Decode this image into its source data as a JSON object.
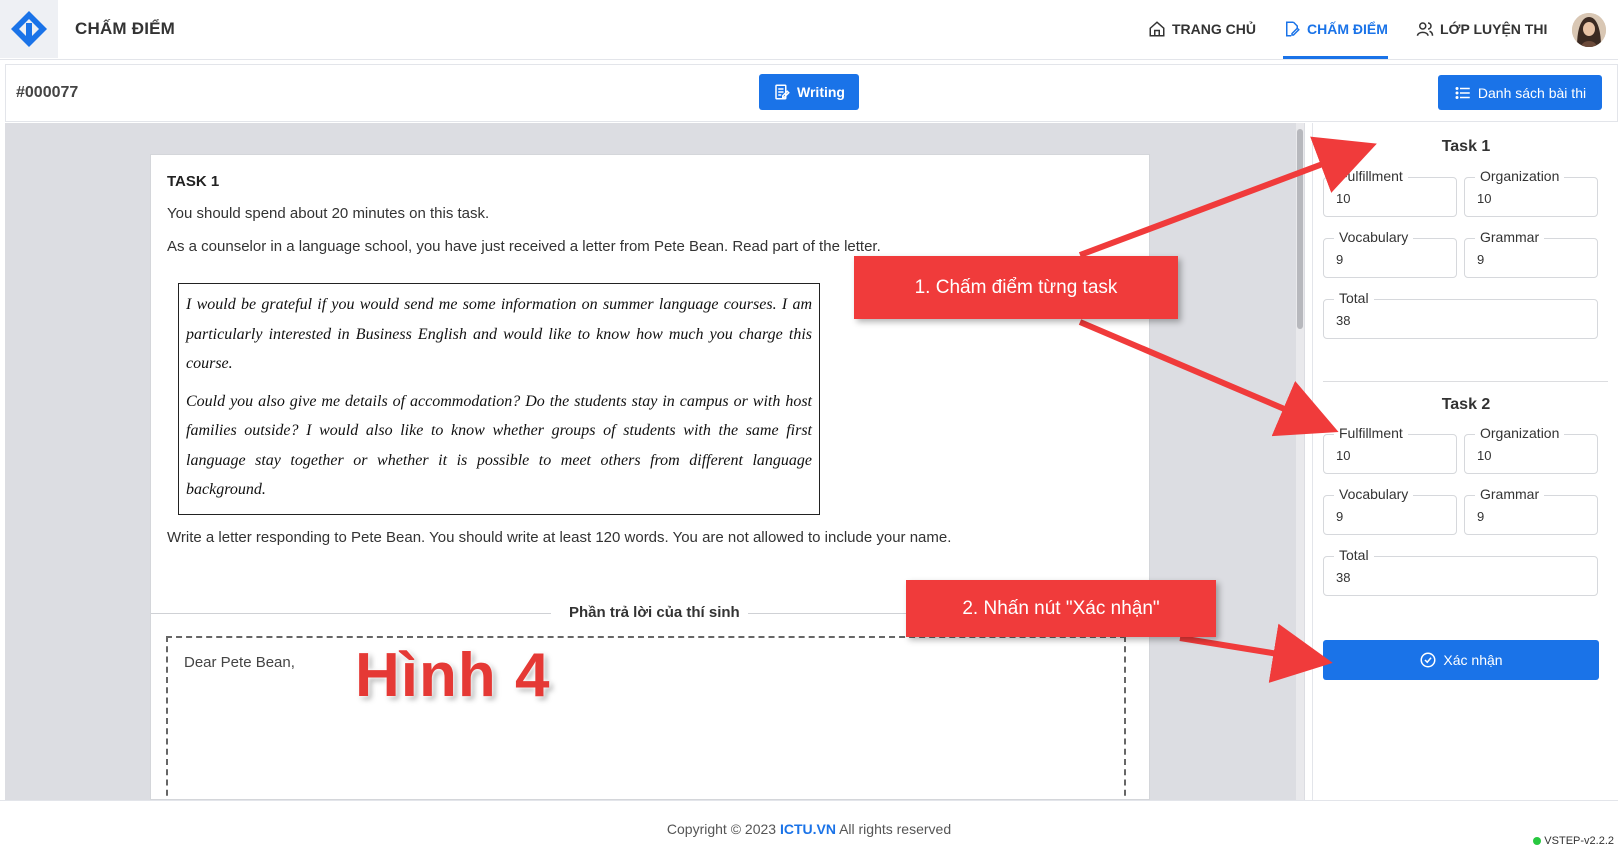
{
  "header": {
    "app_title": "CHẤM ĐIỂM",
    "nav": [
      {
        "label": "TRANG CHỦ",
        "icon": "home-icon"
      },
      {
        "label": "CHẤM ĐIỂM",
        "icon": "edit-document-icon",
        "active": true
      },
      {
        "label": "LỚP LUYỆN THI",
        "icon": "users-icon"
      }
    ],
    "accent_color": "#1a73e8"
  },
  "subheader": {
    "exam_id": "#000077",
    "skill_button": "Writing",
    "list_button": "Danh sách bài thi"
  },
  "task": {
    "heading": "TASK 1",
    "line1": "You should spend about 20 minutes on this task.",
    "line2": "As a counselor in a language school, you have just received a letter from Pete Bean. Read part of the letter.",
    "letter_p1": "I would be grateful if you would send me some information on summer language courses. I am particularly interested in Business English and would like to know how much you charge this course.",
    "letter_p2": "Could you also give me details of accommodation? Do the students stay in campus or with host families outside? I would also like to know whether groups of students with the same first language stay together or whether it is possible to meet others from different language background.",
    "instruction": "Write a letter responding to Pete Bean. You should write at least 120 words. You are not allowed to include your name.",
    "answer_label": "Phần trả lời của thí sinh",
    "answer_text": "Dear Pete Bean,"
  },
  "overlay_text": "Hình 4",
  "scoring": {
    "task1": {
      "title": "Task 1",
      "fulfillment_label": "Fulfillment",
      "fulfillment": "10",
      "organization_label": "Organization",
      "organization": "10",
      "vocabulary_label": "Vocabulary",
      "vocabulary": "9",
      "grammar_label": "Grammar",
      "grammar": "9",
      "total_label": "Total",
      "total": "38"
    },
    "task2": {
      "title": "Task 2",
      "fulfillment_label": "Fulfillment",
      "fulfillment": "10",
      "organization_label": "Organization",
      "organization": "10",
      "vocabulary_label": "Vocabulary",
      "vocabulary": "9",
      "grammar_label": "Grammar",
      "grammar": "9",
      "total_label": "Total",
      "total": "38"
    },
    "confirm_button": "Xác nhận"
  },
  "callouts": {
    "step1": "1. Chấm điểm từng task",
    "step2": "2. Nhấn nút \"Xác nhận\""
  },
  "footer": {
    "copyright_prefix": "Copyright © 2023",
    "brand": "ICTU.VN",
    "copyright_suffix": "All rights reserved",
    "version": "VSTEP-v2.2.2"
  }
}
